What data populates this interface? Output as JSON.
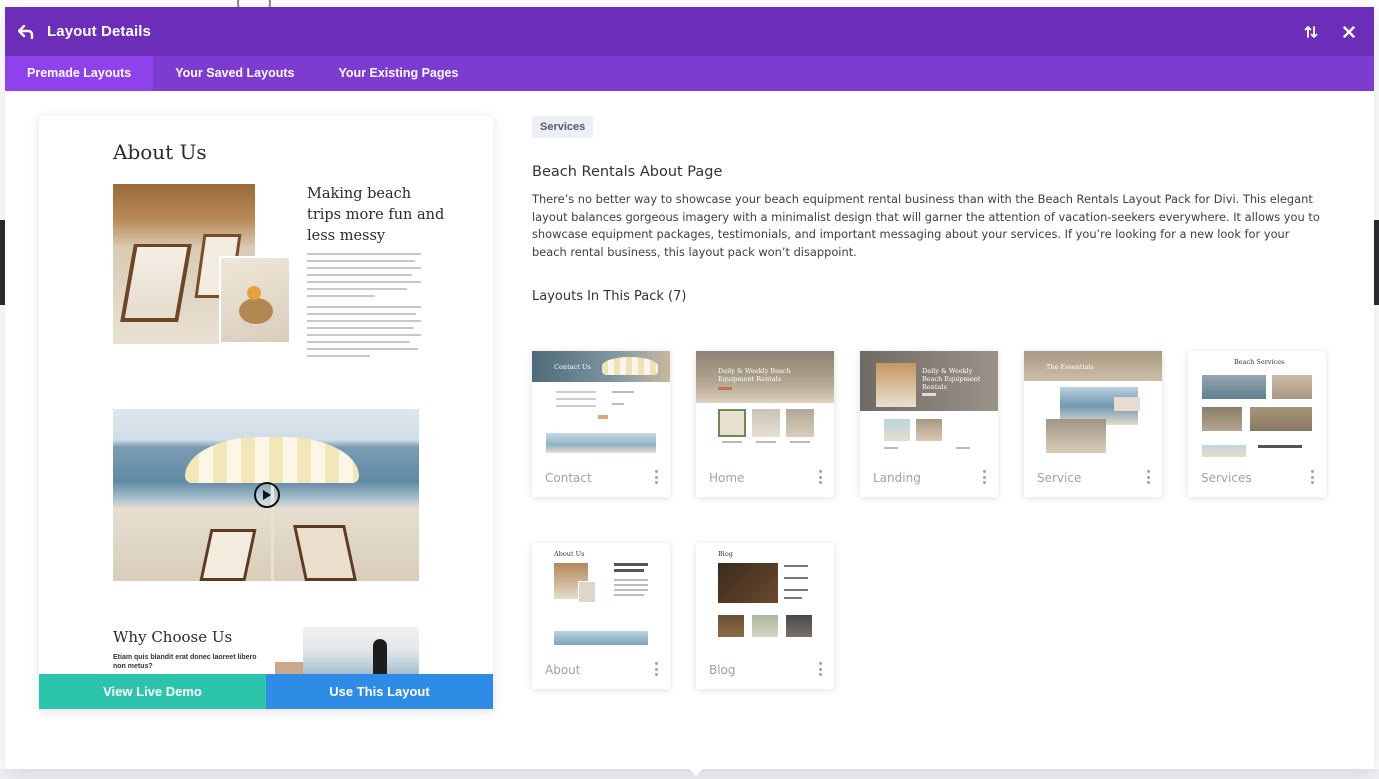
{
  "header": {
    "title": "Layout Details"
  },
  "tabs": [
    {
      "label": "Premade Layouts",
      "active": true
    },
    {
      "label": "Your Saved Layouts",
      "active": false
    },
    {
      "label": "Your Existing Pages",
      "active": false
    }
  ],
  "preview": {
    "heading": "About Us",
    "subheading": "Making beach trips more fun and less messy",
    "section_heading": "Why Choose Us",
    "section_text": "Etiam quis blandit erat donec laoreet libero non metus?",
    "buttons": {
      "demo": "View Live Demo",
      "use": "Use This Layout"
    }
  },
  "details": {
    "category": "Services",
    "title": "Beach Rentals About Page",
    "description": "There’s no better way to showcase your beach equipment rental business than with the Beach Rentals Layout Pack for Divi. This elegant layout balances gorgeous imagery with a minimalist design that will garner the attention of vacation-seekers everywhere. It allows you to showcase equipment packages, testimonials, and important messaging about your services. If you’re looking for a new look for your beach rental business, this layout pack won’t disappoint.",
    "pack_title": "Layouts In This Pack (7)"
  },
  "layouts": [
    {
      "name": "Contact",
      "thumb_title": "Contact Us"
    },
    {
      "name": "Home",
      "thumb_title": "Daily & Weekly Beach Equipment Rentals"
    },
    {
      "name": "Landing",
      "thumb_title": "Daily & Weekly Beach Equipment Rentals"
    },
    {
      "name": "Service",
      "thumb_title": "The Essentials"
    },
    {
      "name": "Services",
      "thumb_title": "Beach Services"
    },
    {
      "name": "About",
      "thumb_title": "About Us"
    },
    {
      "name": "Blog",
      "thumb_title": "Blog"
    }
  ],
  "colors": {
    "header": "#6c2eb9",
    "tabs": "#7e3bd0",
    "tab_active": "#8f42ec",
    "demo_button": "#2cc4ab",
    "use_button": "#2e8ce6"
  },
  "icons": [
    "back-icon",
    "sort-icon",
    "close-icon",
    "play-icon",
    "kebab-icon"
  ]
}
